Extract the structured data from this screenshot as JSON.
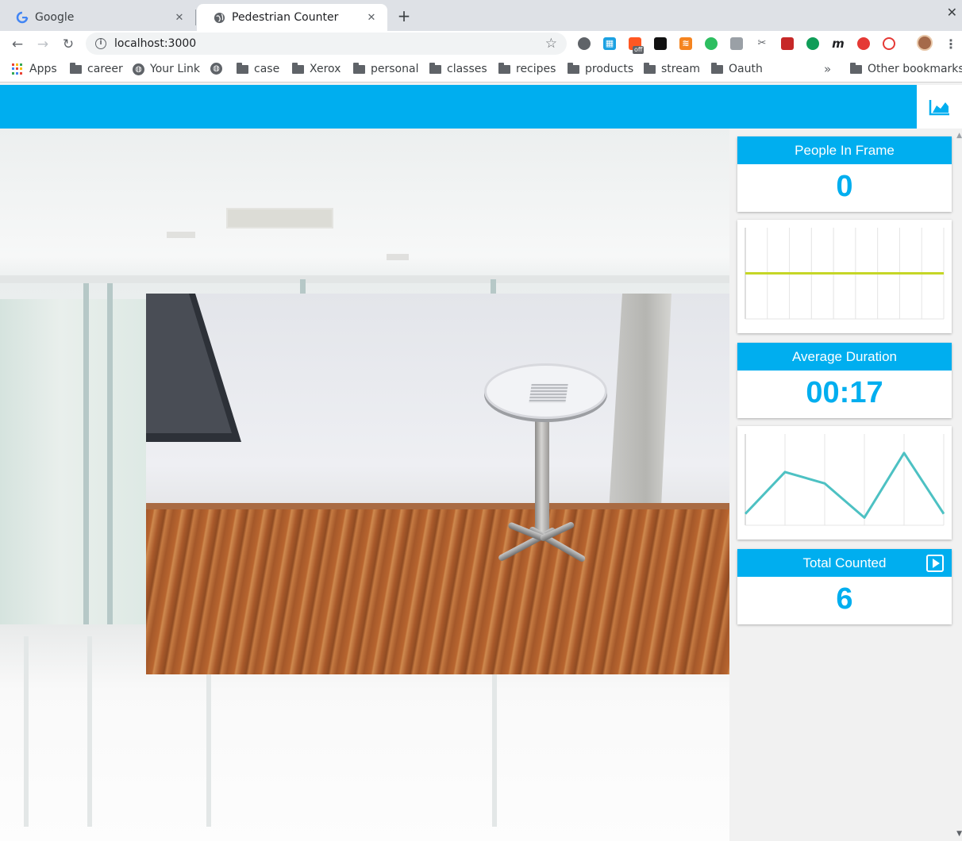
{
  "browser": {
    "tabs": [
      {
        "title": "Google",
        "active": false
      },
      {
        "title": "Pedestrian Counter",
        "active": true
      }
    ],
    "url": "localhost:3000",
    "extension_badge": "off",
    "bookmarks": [
      {
        "label": "Apps",
        "icon": "apps-grid-icon"
      },
      {
        "label": "career",
        "icon": "folder-icon"
      },
      {
        "label": "Your Link",
        "icon": "globe-icon"
      },
      {
        "label": "",
        "icon": "globe-icon"
      },
      {
        "label": "case",
        "icon": "folder-icon"
      },
      {
        "label": "Xerox",
        "icon": "folder-icon"
      },
      {
        "label": "personal",
        "icon": "folder-icon"
      },
      {
        "label": "classes",
        "icon": "folder-icon"
      },
      {
        "label": "recipes",
        "icon": "folder-icon"
      },
      {
        "label": "products",
        "icon": "folder-icon"
      },
      {
        "label": "stream",
        "icon": "folder-icon"
      },
      {
        "label": "Oauth",
        "icon": "folder-icon"
      }
    ],
    "more_bookmarks": "»",
    "other_bookmarks": "Other bookmarks"
  },
  "app": {
    "accent_color": "#00aeef",
    "toggle_icon": "area-chart-icon",
    "stats": {
      "people_in_frame": {
        "label": "People In Frame",
        "value": "0"
      },
      "average_duration": {
        "label": "Average Duration",
        "value": "00:17"
      },
      "total_counted": {
        "label": "Total Counted",
        "value": "6",
        "icon": "play-icon"
      }
    }
  },
  "chart_data": [
    {
      "type": "line",
      "title": "",
      "color": "#c5d626",
      "grid": true,
      "series": [
        {
          "values": [
            0,
            0,
            0,
            0,
            0,
            0,
            0,
            0,
            0,
            0
          ]
        }
      ],
      "ylim": [
        -4,
        4
      ]
    },
    {
      "type": "line",
      "title": "",
      "color": "#4dc1c3",
      "grid": true,
      "series": [
        {
          "values": [
            3,
            14,
            11,
            2,
            19,
            3
          ]
        }
      ],
      "ylim": [
        0,
        24
      ]
    }
  ]
}
